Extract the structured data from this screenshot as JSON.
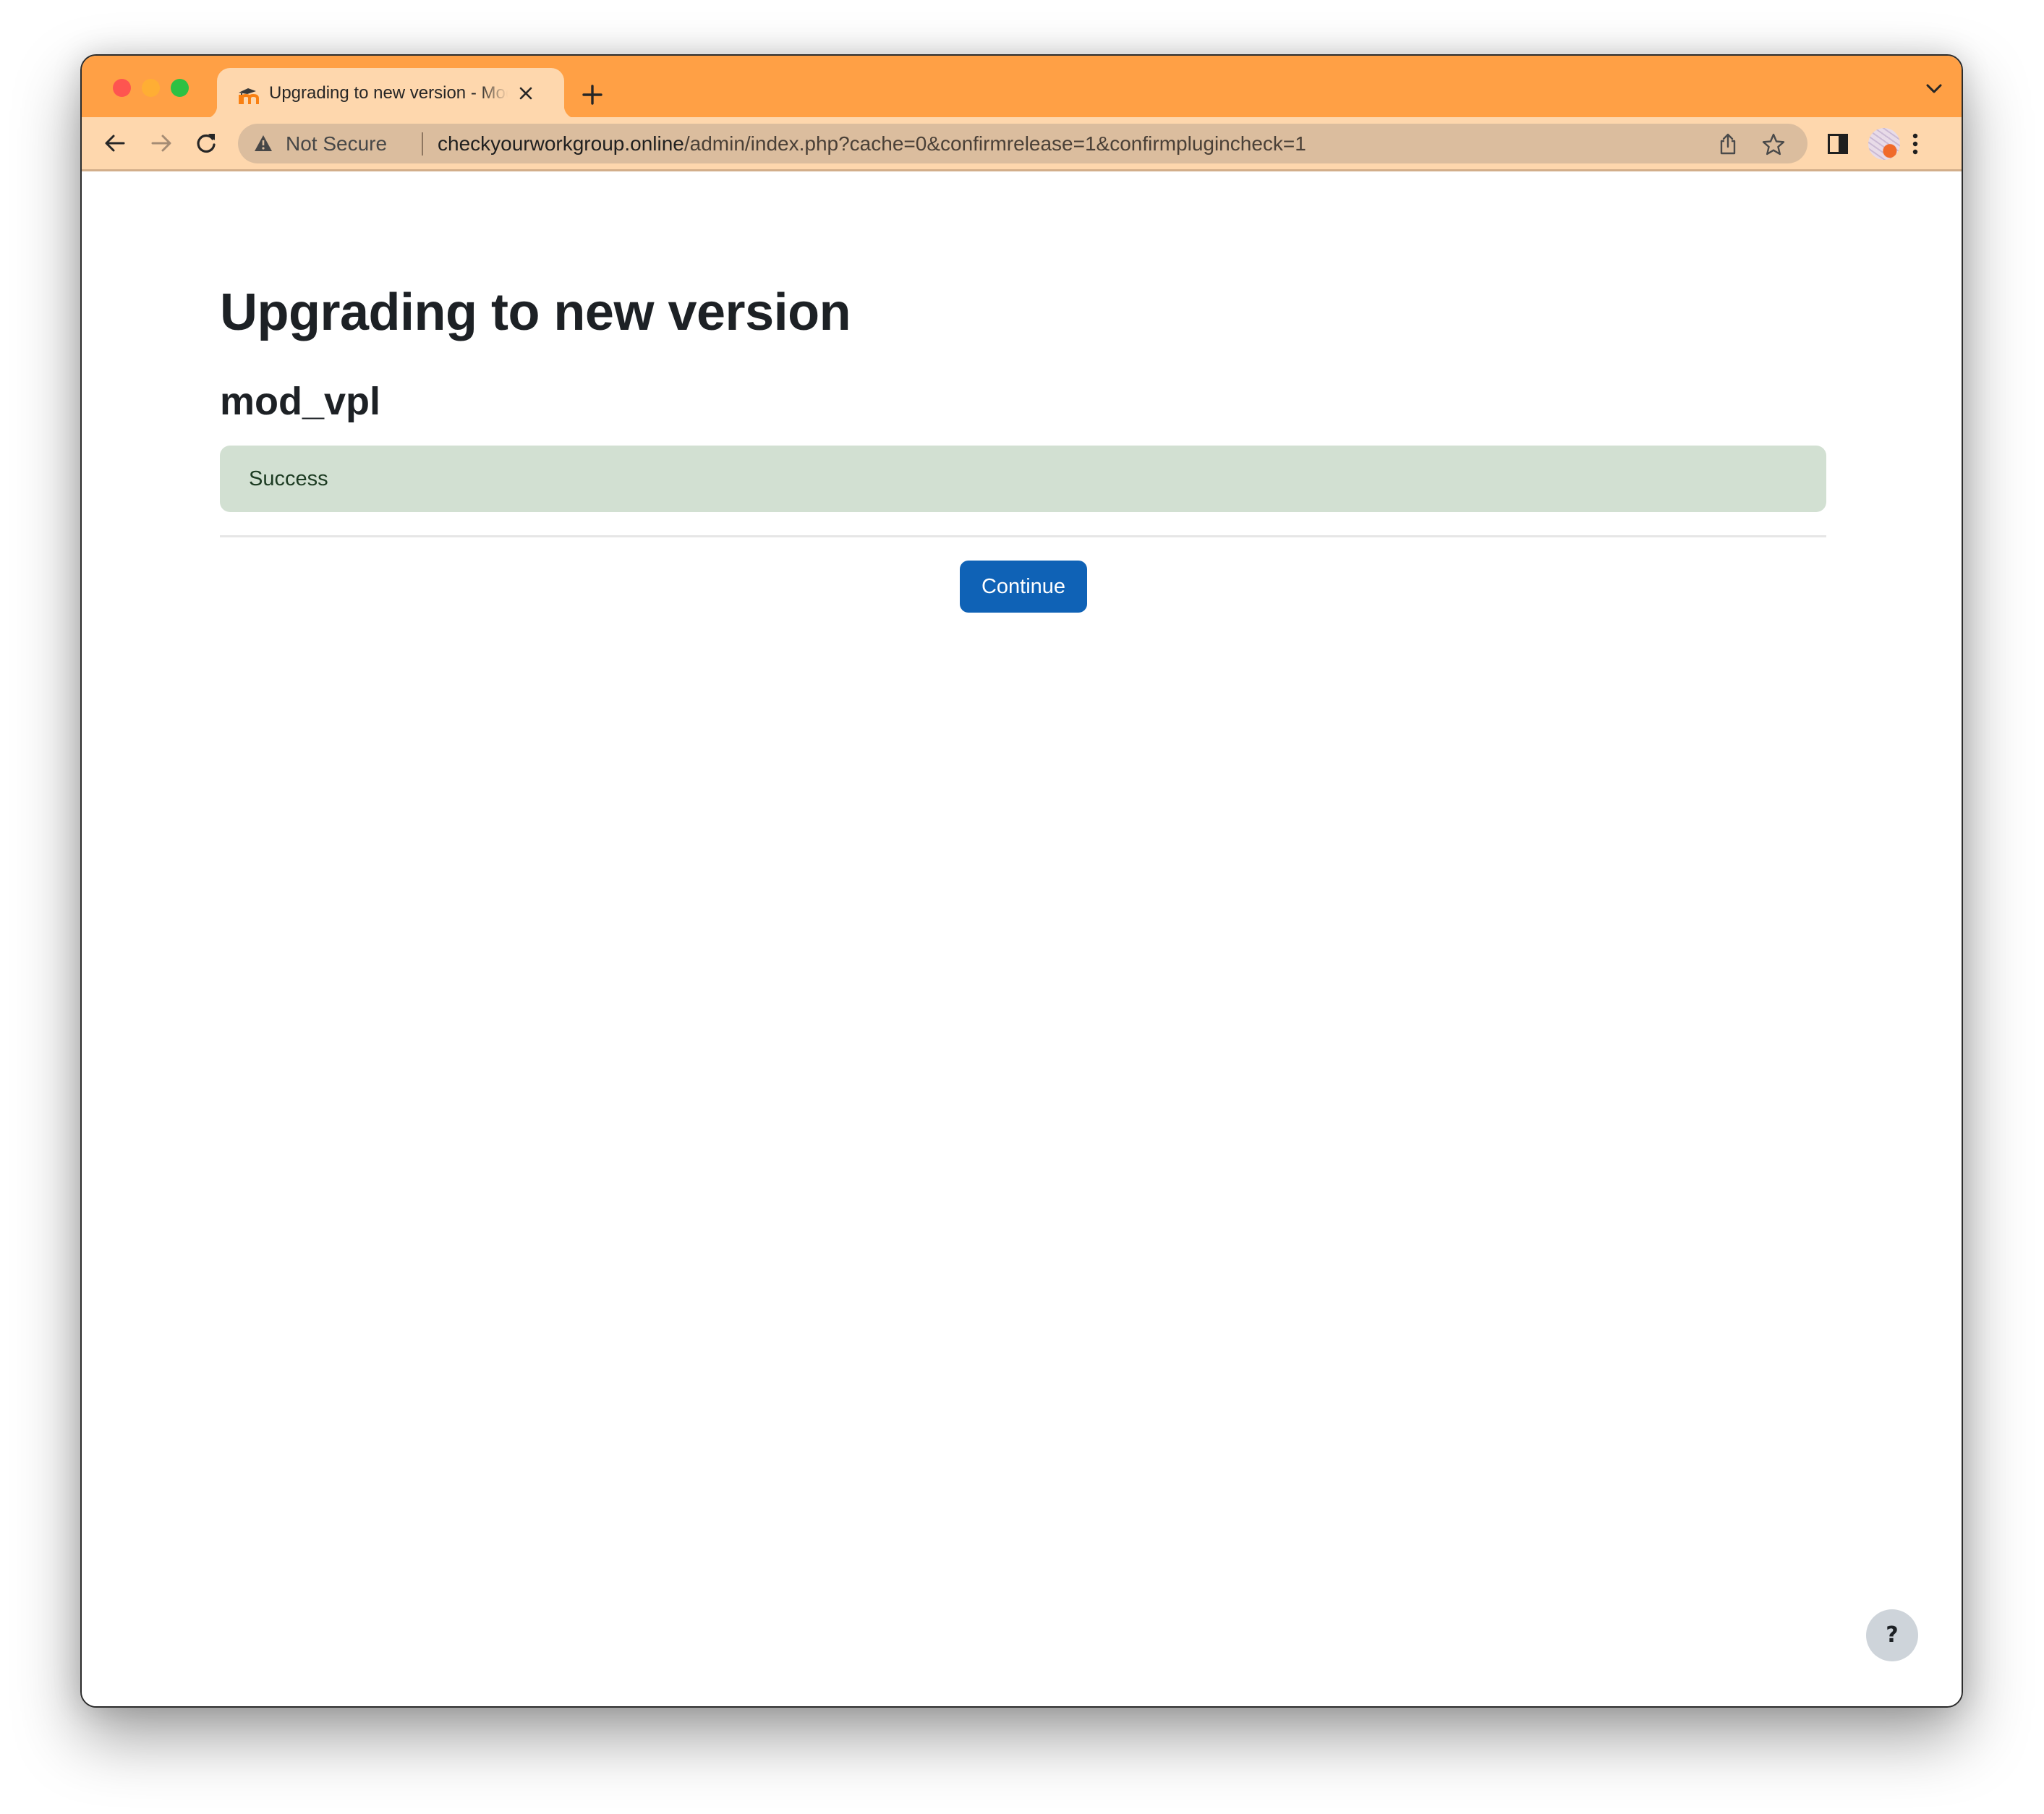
{
  "browser": {
    "tab": {
      "title": "Upgrading to new version - Moodle",
      "favicon": "moodle-icon",
      "close_icon": "close-icon"
    },
    "new_tab_icon": "plus-icon",
    "new_tab_label": "+",
    "tab_close_label": "✕",
    "tab_search_icon": "chevron-down-icon",
    "nav": {
      "back_icon": "arrow-left-icon",
      "forward_icon": "arrow-right-icon",
      "reload_icon": "reload-icon"
    },
    "omnibox": {
      "security_icon": "warning-icon",
      "security_label": "Not Secure",
      "url_host": "checkyourworkgroup.online",
      "url_path": "/admin/index.php?cache=0&confirmrelease=1&confirmplugincheck=1",
      "share_icon": "share-icon",
      "bookmark_icon": "star-icon"
    },
    "side_panel_icon": "side-panel-icon",
    "profile_icon": "avatar",
    "menu_icon": "more-vertical-icon",
    "colors": {
      "tabstrip": "#ffa045",
      "toolbar": "#fed7ad",
      "omnibox": "#dbbd9e"
    }
  },
  "page": {
    "title": "Upgrading to new version",
    "plugin_heading": "mod_vpl",
    "alert": {
      "type": "success",
      "text": "Success",
      "background": "#d2e0d2"
    },
    "continue_label": "Continue",
    "continue_color": "#0f62b6",
    "help_label": "?"
  }
}
